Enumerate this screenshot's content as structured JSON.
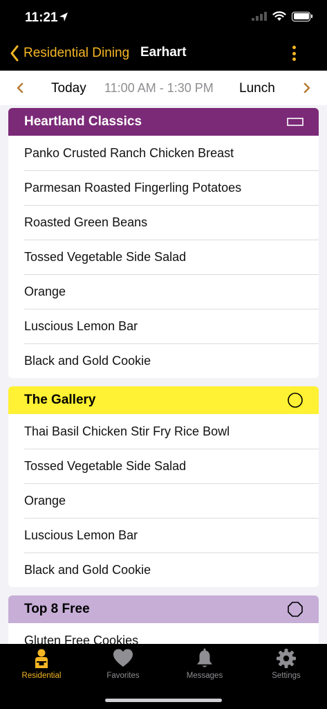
{
  "status_bar": {
    "time": "11:21"
  },
  "nav": {
    "back_label": "Residential Dining",
    "title": "Earhart"
  },
  "date_bar": {
    "day": "Today",
    "time_range": "11:00 AM - 1:30 PM",
    "meal": "Lunch"
  },
  "sections": [
    {
      "title": "Heartland Classics",
      "color": "#7b2a77",
      "title_color": "#ffffff",
      "icon": "rectangle-icon",
      "items": [
        "Panko Crusted Ranch Chicken Breast",
        "Parmesan Roasted Fingerling Potatoes",
        "Roasted Green Beans",
        "Tossed Vegetable Side Salad",
        "Orange",
        "Luscious Lemon Bar",
        "Black and Gold Cookie"
      ]
    },
    {
      "title": "The Gallery",
      "color": "#fff133",
      "title_color": "#000000",
      "icon": "circle-icon",
      "items": [
        "Thai Basil  Chicken Stir Fry Rice Bowl",
        "Tossed Vegetable Side Salad",
        "Orange",
        "Luscious Lemon Bar",
        "Black and Gold Cookie"
      ]
    },
    {
      "title": "Top 8 Free",
      "color": "#c6aed7",
      "title_color": "#000000",
      "icon": "octagon-icon",
      "items": [
        "Gluten Free Cookies"
      ]
    }
  ],
  "tabs": [
    {
      "label": "Residential",
      "icon": "dining-person-icon",
      "active": true
    },
    {
      "label": "Favorites",
      "icon": "heart-icon",
      "active": false
    },
    {
      "label": "Messages",
      "icon": "bell-icon",
      "active": false
    },
    {
      "label": "Settings",
      "icon": "gear-icon",
      "active": false
    }
  ],
  "colors": {
    "accent": "#f5b624",
    "inactive": "#8e8e93",
    "bar_background": "#000000"
  }
}
